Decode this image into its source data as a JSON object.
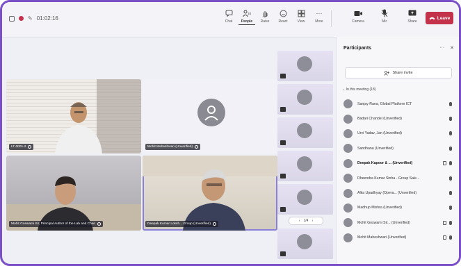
{
  "topbar": {
    "timer": "01:02:16",
    "tools": [
      {
        "id": "chat",
        "label": "Chat"
      },
      {
        "id": "people",
        "label": "People",
        "count": "18"
      },
      {
        "id": "raise",
        "label": "Raise"
      },
      {
        "id": "react",
        "label": "React"
      },
      {
        "id": "view",
        "label": "View"
      },
      {
        "id": "more",
        "label": "More"
      },
      {
        "id": "camera",
        "label": "Camera"
      },
      {
        "id": "mic",
        "label": "Mic"
      },
      {
        "id": "share",
        "label": "Share"
      }
    ],
    "leave_label": "Leave"
  },
  "grid": {
    "tiles": [
      {
        "name": "LT 0001-2"
      },
      {
        "name": "Mohit Maheshwari (Unverified)"
      },
      {
        "name": "Mohit Goswami Sir, Principal Author of the Lab and Chair"
      },
      {
        "name": "Deepak Kumar Loksh... Group (Unverified)"
      }
    ]
  },
  "filmstrip": {
    "pager_label": "1/4"
  },
  "panel": {
    "title": "Participants",
    "share_label": "Share invite",
    "section_label": "In this meeting (18)",
    "participants": [
      {
        "name": "Sanjay Rana, Global Platform ICT"
      },
      {
        "name": "Badari Chandel (Unverified)"
      },
      {
        "name": "Urvi Yadav, Jan (Unverified)"
      },
      {
        "name": "Sandhana (Unverified)"
      },
      {
        "name": "Deepak Kapoor & ... (Unverified)"
      },
      {
        "name": "Dheendra Kumar Sinha - Group Sale..."
      },
      {
        "name": "Alka Upadhyay (Opera... (Unverified)"
      },
      {
        "name": "Madhup Mishra (Unverified)"
      },
      {
        "name": "Mohit Goswami Sir... (Unverified)"
      },
      {
        "name": "Mohit Maheshwari (Unverified)"
      }
    ],
    "colors": {
      "accent": "#c4314b",
      "brand": "#6264a7"
    }
  }
}
